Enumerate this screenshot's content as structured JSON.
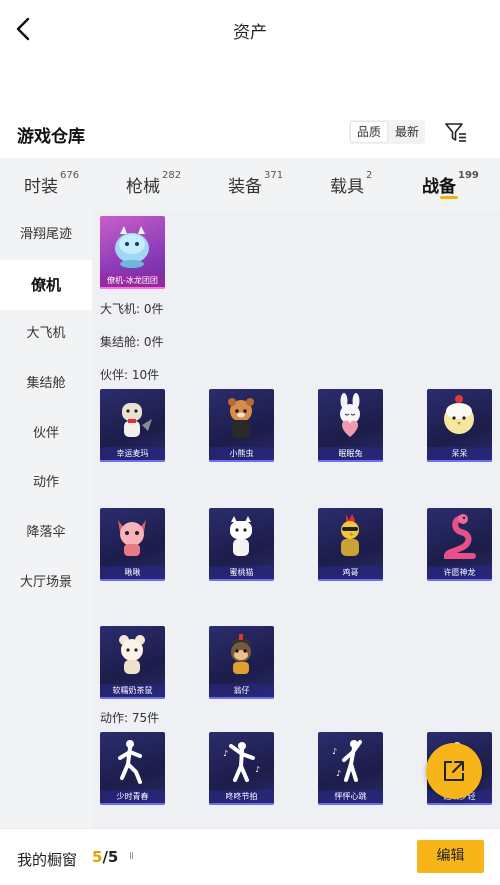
{
  "header": {
    "title": "资产"
  },
  "warehouse": {
    "title": "游戏仓库",
    "sort_options": [
      "品质",
      "最新"
    ]
  },
  "tabs": [
    {
      "label": "时装",
      "count": "676"
    },
    {
      "label": "枪械",
      "count": "282"
    },
    {
      "label": "装备",
      "count": "371"
    },
    {
      "label": "载具",
      "count": "2"
    },
    {
      "label": "战备",
      "count": "199"
    }
  ],
  "sidebar": [
    {
      "label": "滑翔尾迹"
    },
    {
      "label": "僚机"
    },
    {
      "label": "大飞机"
    },
    {
      "label": "集结舱"
    },
    {
      "label": "伙伴"
    },
    {
      "label": "动作"
    },
    {
      "label": "降落伞"
    },
    {
      "label": "大厅场景"
    }
  ],
  "sections": {
    "wingman_item": "僚机-冰龙团团",
    "big_plane": "大飞机: 0件",
    "capsule": "集结舱: 0件",
    "partners_label": "伙伴: 10件",
    "partners": [
      "幸运麦玛",
      "小熊虫",
      "眠眠兔",
      "呆呆",
      "啾啾",
      "蜜桃猫",
      "鸡哥",
      "许愿神龙",
      "软糯奶茶鼠",
      "翁仔"
    ],
    "actions_label": "动作: 75件",
    "actions": [
      "少时青春",
      "咚咚节拍",
      "怦怦心跳",
      "超现步轻"
    ]
  },
  "bottom": {
    "label": "我的橱窗",
    "count_current": "5",
    "count_total": "/5",
    "lock_glyph": "Ⅱ",
    "edit_label": "编辑"
  },
  "colors": {
    "accent": "#f7b51a",
    "card_bg": "#1c1d4a",
    "sidebar_bg": "#f2f3f5"
  }
}
